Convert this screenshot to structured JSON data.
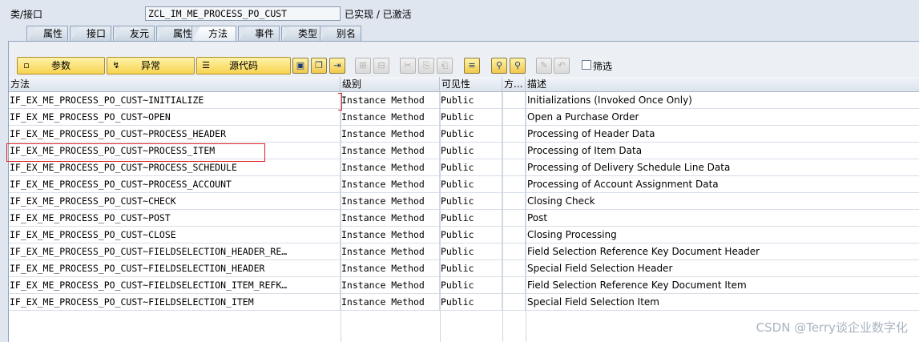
{
  "header": {
    "label": "类/接口",
    "class_name": "ZCL_IM_ME_PROCESS_PO_CUST",
    "status": "已实现 / 已激活"
  },
  "tabs": [
    {
      "label": "属性"
    },
    {
      "label": "接口"
    },
    {
      "label": "友元"
    },
    {
      "label": "属性"
    },
    {
      "label": "方法",
      "active": true
    },
    {
      "label": "事件"
    },
    {
      "label": "类型"
    },
    {
      "label": "别名"
    }
  ],
  "toolbar": {
    "params_label": "参数",
    "exceptions_label": "异常",
    "source_label": "源代码",
    "filter_label": "筛选"
  },
  "table": {
    "columns": [
      "方法",
      "级别",
      "可见性",
      "方...",
      "描述"
    ],
    "rows": [
      {
        "method": "IF_EX_ME_PROCESS_PO_CUST~INITIALIZE",
        "level": "Instance Method",
        "visibility": "Public",
        "flag": "",
        "desc": "Initializations (Invoked Once Only)"
      },
      {
        "method": "IF_EX_ME_PROCESS_PO_CUST~OPEN",
        "level": "Instance Method",
        "visibility": "Public",
        "flag": "",
        "desc": "Open a Purchase Order"
      },
      {
        "method": "IF_EX_ME_PROCESS_PO_CUST~PROCESS_HEADER",
        "level": "Instance Method",
        "visibility": "Public",
        "flag": "",
        "desc": "Processing of Header Data"
      },
      {
        "method": "IF_EX_ME_PROCESS_PO_CUST~PROCESS_ITEM",
        "level": "Instance Method",
        "visibility": "Public",
        "flag": "",
        "desc": "Processing of Item Data"
      },
      {
        "method": "IF_EX_ME_PROCESS_PO_CUST~PROCESS_SCHEDULE",
        "level": "Instance Method",
        "visibility": "Public",
        "flag": "",
        "desc": "Processing of Delivery Schedule Line Data"
      },
      {
        "method": "IF_EX_ME_PROCESS_PO_CUST~PROCESS_ACCOUNT",
        "level": "Instance Method",
        "visibility": "Public",
        "flag": "",
        "desc": "Processing of Account Assignment Data"
      },
      {
        "method": "IF_EX_ME_PROCESS_PO_CUST~CHECK",
        "level": "Instance Method",
        "visibility": "Public",
        "flag": "",
        "desc": "Closing Check"
      },
      {
        "method": "IF_EX_ME_PROCESS_PO_CUST~POST",
        "level": "Instance Method",
        "visibility": "Public",
        "flag": "",
        "desc": "Post"
      },
      {
        "method": "IF_EX_ME_PROCESS_PO_CUST~CLOSE",
        "level": "Instance Method",
        "visibility": "Public",
        "flag": "",
        "desc": "Closing Processing"
      },
      {
        "method": "IF_EX_ME_PROCESS_PO_CUST~FIELDSELECTION_HEADER_RE…",
        "level": "Instance Method",
        "visibility": "Public",
        "flag": "",
        "desc": "Field Selection Reference Key Document Header"
      },
      {
        "method": "IF_EX_ME_PROCESS_PO_CUST~FIELDSELECTION_HEADER",
        "level": "Instance Method",
        "visibility": "Public",
        "flag": "",
        "desc": "Special Field Selection Header"
      },
      {
        "method": "IF_EX_ME_PROCESS_PO_CUST~FIELDSELECTION_ITEM_REFK…",
        "level": "Instance Method",
        "visibility": "Public",
        "flag": "",
        "desc": "Field Selection Reference Key Document Item"
      },
      {
        "method": "IF_EX_ME_PROCESS_PO_CUST~FIELDSELECTION_ITEM",
        "level": "Instance Method",
        "visibility": "Public",
        "flag": "",
        "desc": "Special Field Selection Item"
      }
    ]
  },
  "watermark": "CSDN @Terry谈企业数字化"
}
